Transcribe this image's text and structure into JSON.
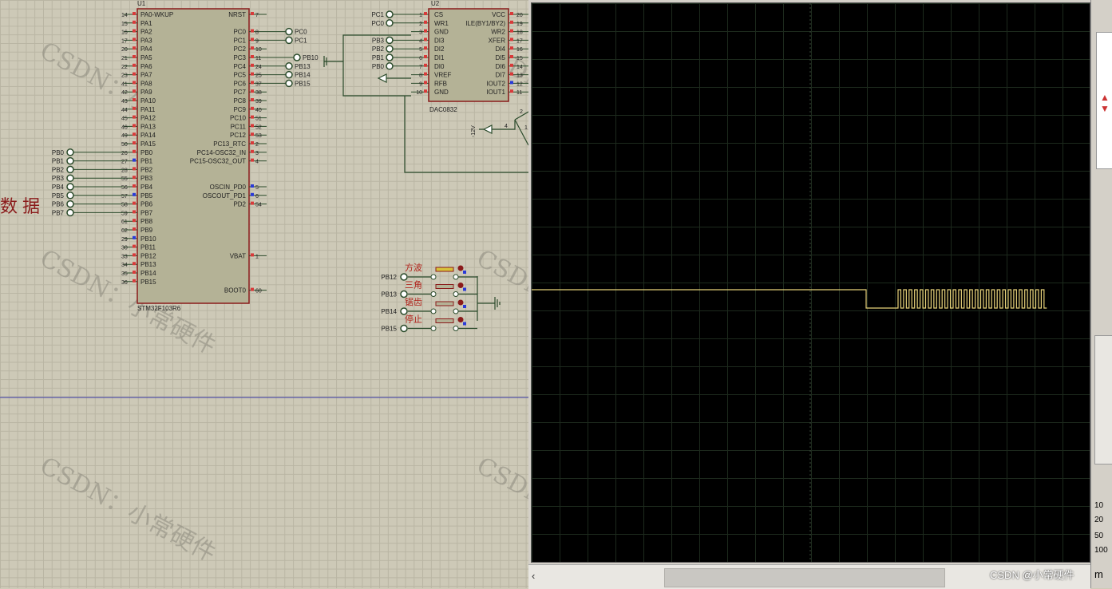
{
  "watermark": "CSDN：小常硬件",
  "side_label": "数据",
  "credit": "CSDN @小常硬件",
  "u1": {
    "ref": "U1",
    "part": "STM32F103R6",
    "left_pins": [
      {
        "num": "14",
        "name": "PA0-WKUP"
      },
      {
        "num": "15",
        "name": "PA1"
      },
      {
        "num": "16",
        "name": "PA2"
      },
      {
        "num": "17",
        "name": "PA3"
      },
      {
        "num": "20",
        "name": "PA4"
      },
      {
        "num": "21",
        "name": "PA5"
      },
      {
        "num": "22",
        "name": "PA6"
      },
      {
        "num": "23",
        "name": "PA7"
      },
      {
        "num": "41",
        "name": "PA8"
      },
      {
        "num": "42",
        "name": "PA9"
      },
      {
        "num": "43",
        "name": "PA10"
      },
      {
        "num": "44",
        "name": "PA11"
      },
      {
        "num": "45",
        "name": "PA12"
      },
      {
        "num": "46",
        "name": "PA13"
      },
      {
        "num": "49",
        "name": "PA14"
      },
      {
        "num": "50",
        "name": "PA15"
      },
      {
        "num": "26",
        "name": "PB0"
      },
      {
        "num": "27",
        "name": "PB1"
      },
      {
        "num": "28",
        "name": "PB2"
      },
      {
        "num": "55",
        "name": "PB3"
      },
      {
        "num": "56",
        "name": "PB4"
      },
      {
        "num": "57",
        "name": "PB5"
      },
      {
        "num": "58",
        "name": "PB6"
      },
      {
        "num": "59",
        "name": "PB7"
      },
      {
        "num": "61",
        "name": "PB8"
      },
      {
        "num": "62",
        "name": "PB9"
      },
      {
        "num": "29",
        "name": "PB10"
      },
      {
        "num": "30",
        "name": "PB11"
      },
      {
        "num": "33",
        "name": "PB12"
      },
      {
        "num": "34",
        "name": "PB13"
      },
      {
        "num": "35",
        "name": "PB14"
      },
      {
        "num": "36",
        "name": "PB15"
      }
    ],
    "right_pins": [
      {
        "num": "7",
        "name": "NRST",
        "row": 0
      },
      {
        "num": "8",
        "name": "PC0",
        "row": 2
      },
      {
        "num": "9",
        "name": "PC1",
        "row": 3
      },
      {
        "num": "10",
        "name": "PC2",
        "row": 4
      },
      {
        "num": "11",
        "name": "PC3",
        "row": 5
      },
      {
        "num": "24",
        "name": "PC4",
        "row": 6
      },
      {
        "num": "25",
        "name": "PC5",
        "row": 7
      },
      {
        "num": "37",
        "name": "PC6",
        "row": 8
      },
      {
        "num": "38",
        "name": "PC7",
        "row": 9
      },
      {
        "num": "39",
        "name": "PC8",
        "row": 10
      },
      {
        "num": "40",
        "name": "PC9",
        "row": 11
      },
      {
        "num": "51",
        "name": "PC10",
        "row": 12
      },
      {
        "num": "52",
        "name": "PC11",
        "row": 13
      },
      {
        "num": "53",
        "name": "PC12",
        "row": 14
      },
      {
        "num": "2",
        "name": "PC13_RTC",
        "row": 15
      },
      {
        "num": "3",
        "name": "PC14-OSC32_IN",
        "row": 16
      },
      {
        "num": "4",
        "name": "PC15-OSC32_OUT",
        "row": 17
      },
      {
        "num": "5",
        "name": "OSCIN_PD0",
        "row": 20
      },
      {
        "num": "6",
        "name": "OSCOUT_PD1",
        "row": 21
      },
      {
        "num": "54",
        "name": "PD2",
        "row": 22
      },
      {
        "num": "1",
        "name": "VBAT",
        "row": 28
      },
      {
        "num": "60",
        "name": "BOOT0",
        "row": 32
      }
    ],
    "right_terminals": [
      {
        "label": "PC0",
        "row": 2
      },
      {
        "label": "PC1",
        "row": 3
      },
      {
        "label": "PB10",
        "row": 5
      },
      {
        "label": "PB13",
        "row": 6
      },
      {
        "label": "PB14",
        "row": 7
      },
      {
        "label": "PB15",
        "row": 8
      }
    ],
    "left_terminals": [
      "PB0",
      "PB1",
      "PB2",
      "PB3",
      "PB4",
      "PB5",
      "PB6",
      "PB7"
    ]
  },
  "u2": {
    "ref": "U2",
    "part": "DAC0832",
    "left_pins": [
      {
        "num": "1",
        "name": "CS"
      },
      {
        "num": "2",
        "name": "WR1"
      },
      {
        "num": "3",
        "name": "GND"
      },
      {
        "num": "4",
        "name": "DI3"
      },
      {
        "num": "5",
        "name": "DI2"
      },
      {
        "num": "6",
        "name": "DI1"
      },
      {
        "num": "7",
        "name": "DI0"
      },
      {
        "num": "8",
        "name": "VREF"
      },
      {
        "num": "9",
        "name": "RFB"
      },
      {
        "num": "10",
        "name": "GND"
      }
    ],
    "right_pins": [
      {
        "num": "20",
        "name": "VCC"
      },
      {
        "num": "19",
        "name": "ILE(BY1/BY2)"
      },
      {
        "num": "18",
        "name": "WR2"
      },
      {
        "num": "17",
        "name": "XFER"
      },
      {
        "num": "16",
        "name": "DI4"
      },
      {
        "num": "15",
        "name": "DI5"
      },
      {
        "num": "14",
        "name": "DI6"
      },
      {
        "num": "13",
        "name": "DI7"
      },
      {
        "num": "12",
        "name": "IOUT2"
      },
      {
        "num": "11",
        "name": "IOUT1"
      }
    ],
    "left_terminals": [
      {
        "label": "PC1",
        "row": 0
      },
      {
        "label": "PC0",
        "row": 1
      },
      {
        "label": "PB3",
        "row": 3
      },
      {
        "label": "PB2",
        "row": 4
      },
      {
        "label": "PB1",
        "row": 5
      },
      {
        "label": "PB0",
        "row": 6
      }
    ]
  },
  "opamp": {
    "supply_label": "-12V",
    "pin_a": "4",
    "pin_b": "2",
    "pin_c": "1"
  },
  "buttons": [
    {
      "label": "方波",
      "terminal": "PB12"
    },
    {
      "label": "三角",
      "terminal": "PB13"
    },
    {
      "label": "锯齿",
      "terminal": "PB14"
    },
    {
      "label": "停止",
      "terminal": "PB15"
    }
  ],
  "right_panel_numbers": [
    "10",
    "20",
    "50",
    "100"
  ],
  "right_panel_letter": "m",
  "colors": {
    "trace": "#e8d27a",
    "chip_fill": "#b4b296",
    "chip_border": "#8a1a1a",
    "wire": "#2a4a2a",
    "grid_bg": "#cdc9b7",
    "scope_bg": "#000000"
  }
}
